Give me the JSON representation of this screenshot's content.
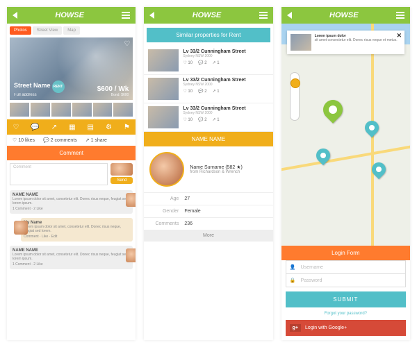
{
  "brand": "HOWSE",
  "screen1": {
    "tabs": [
      "Photos",
      "Street View",
      "Map"
    ],
    "street": "Street Name",
    "address": "Full address",
    "price": "$600 / Wk",
    "bond": "Bond: $600",
    "rent_badge": "RENT",
    "likes": "10 likes",
    "comments": "2 comments",
    "shares": "1 share",
    "comment_btn": "Comment",
    "placeholder": "Comment",
    "send": "Send",
    "msgs": [
      {
        "name": "NAME NAME",
        "body": "Lorem ipsum dolor sit amet, consetetur elit. Donec risus neque, feugiat sed lorem ipsum.",
        "meta": "1 Comment · 2 Like"
      },
      {
        "name": "My Name",
        "body": "Lorem ipsum dolor sit amet, consetetur elit. Donec risus neque, feugiat sed lorem.",
        "meta": "Comment · Like · Edit"
      },
      {
        "name": "NAME NAME",
        "body": "Lorem ipsum dolor sit amet, consetetur elit. Donec risus neque, feugiat sed lorem ipsum.",
        "meta": "1 Comment · 2 Like"
      }
    ]
  },
  "screen2": {
    "banner": "Similar properties for Rent",
    "listings": [
      {
        "title": "Lv 33/2 Cunningham Street",
        "sub": "Sydney NSW 2000",
        "likes": "10",
        "comments": "2",
        "shares": "1"
      },
      {
        "title": "Lv 33/2 Cunningham Street",
        "sub": "Sydney NSW 2000",
        "likes": "10",
        "comments": "2",
        "shares": "1"
      },
      {
        "title": "Lv 33/2 Cunningham Street",
        "sub": "Sydney NSW 2000",
        "likes": "10",
        "comments": "2",
        "shares": "1"
      }
    ],
    "name_bar": "NAME NAME",
    "profile_name": "Name Surname",
    "profile_meta": "(582 ★)",
    "profile_from": "from Richardson & Wrench",
    "kv": [
      {
        "k": "Age",
        "v": "27"
      },
      {
        "k": "Gender",
        "v": "Female"
      },
      {
        "k": "Comments",
        "v": "236"
      }
    ],
    "more": "More"
  },
  "screen3": {
    "popup_title": "Lorem ipsum dolor",
    "popup_body": "sit amet consectetur elit. Donec risus neque et metus.",
    "login_header": "Login Form",
    "username_ph": "Username",
    "password_ph": "Password",
    "submit": "SUBMIT",
    "forgot": "Forgot your password?",
    "google": "Login with Google+"
  }
}
